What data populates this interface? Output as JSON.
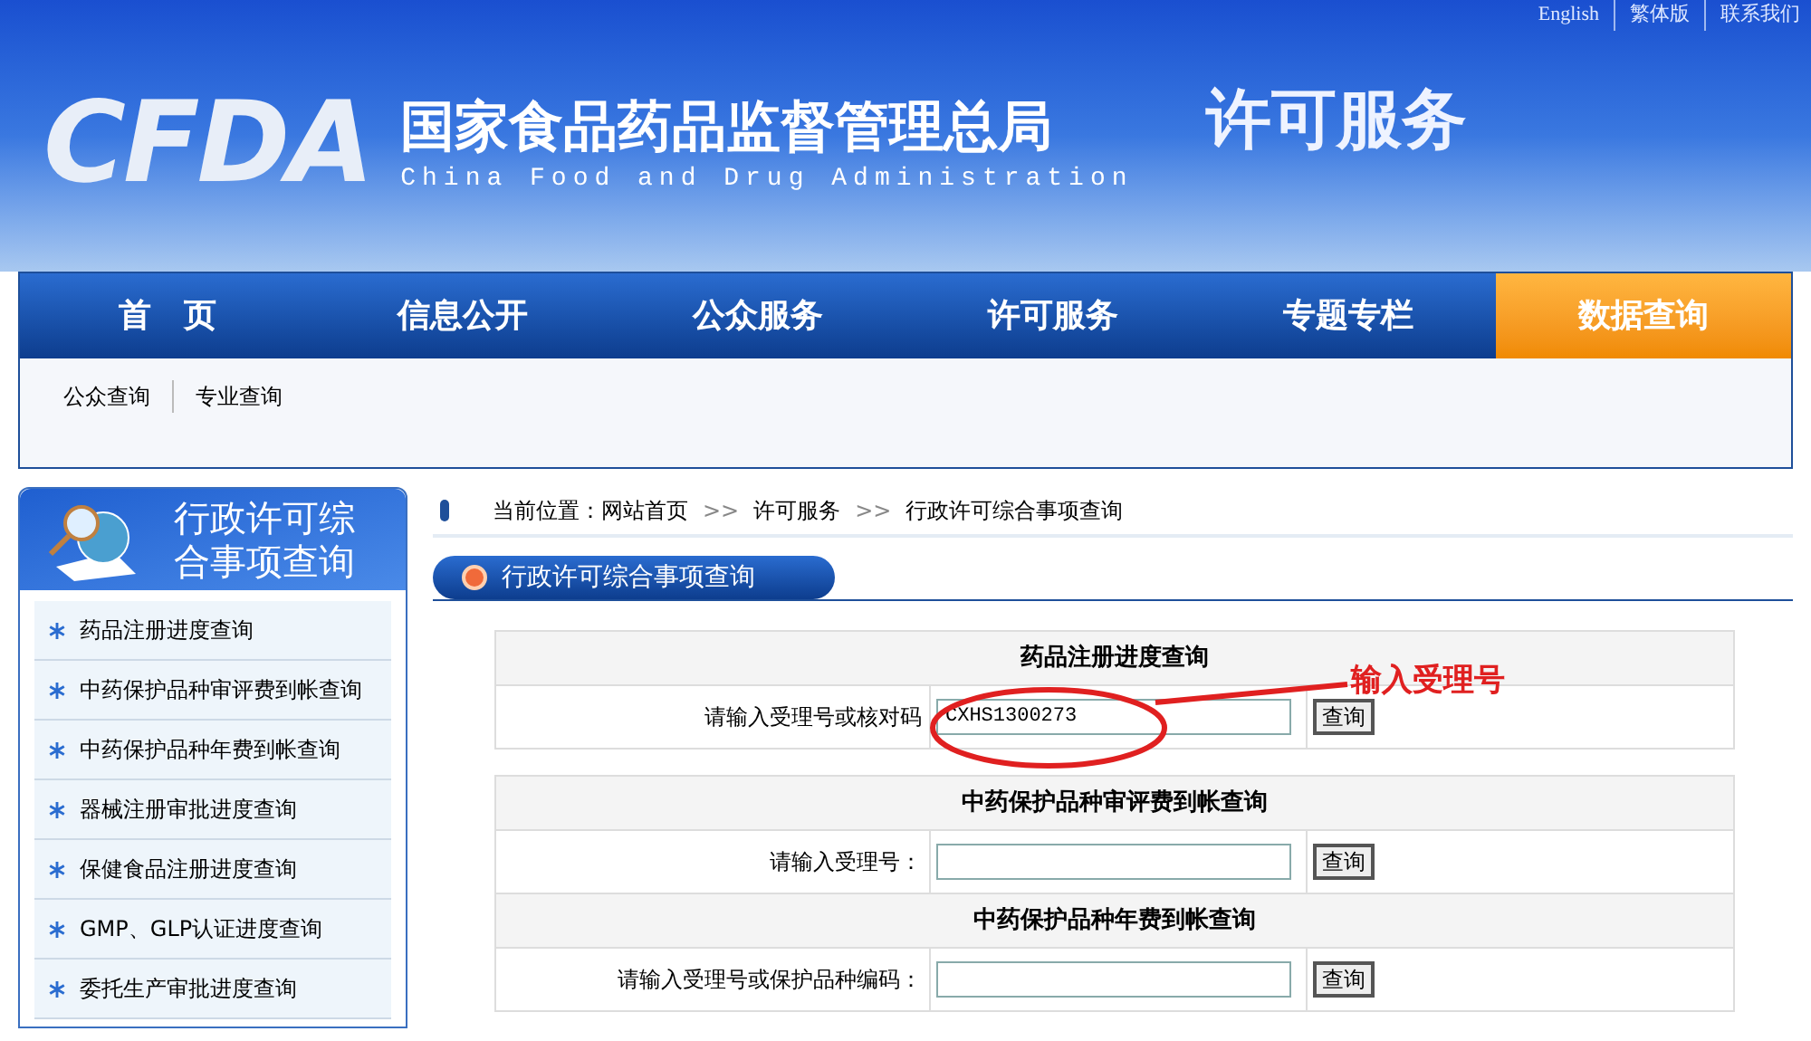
{
  "top_links": [
    "English",
    "繁体版",
    "联系我们"
  ],
  "header": {
    "logo": "CFDA",
    "title": "国家食品药品监督管理总局",
    "subtitle": "China Food and Drug Administration",
    "section": "许可服务"
  },
  "nav": [
    {
      "label": "首　页",
      "selected": false
    },
    {
      "label": "信息公开",
      "selected": false
    },
    {
      "label": "公众服务",
      "selected": false
    },
    {
      "label": "许可服务",
      "selected": false
    },
    {
      "label": "专题专栏",
      "selected": false
    },
    {
      "label": "数据查询",
      "selected": true
    }
  ],
  "subnav": [
    "公众查询",
    "专业查询"
  ],
  "sidebar": {
    "title": "行政许可综合事项查询",
    "items": [
      "药品注册进度查询",
      "中药保护品种审评费到帐查询",
      "中药保护品种年费到帐查询",
      "器械注册审批进度查询",
      "保健食品注册进度查询",
      "GMP、GLP认证进度查询",
      "委托生产审批进度查询"
    ]
  },
  "breadcrumb": [
    "当前位置：网站首页",
    ">>",
    "许可服务",
    ">>",
    "行政许可综合事项查询"
  ],
  "panel_title": "行政许可综合事项查询",
  "queries": [
    {
      "title": "药品注册进度查询",
      "label": "请输入受理号或核对码",
      "value": "CXHS1300273",
      "button": "查询"
    },
    {
      "title": "中药保护品种审评费到帐查询",
      "label": "请输入受理号：",
      "button": "查询"
    },
    {
      "title": "中药保护品种年费到帐查询",
      "label": "请输入受理号或保护品种编码：",
      "button": "查询"
    }
  ],
  "annotation": {
    "label": "输入受理号"
  }
}
